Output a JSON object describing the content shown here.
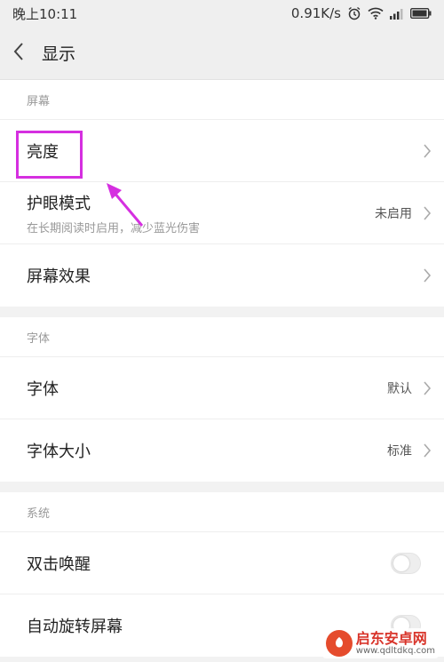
{
  "status_bar": {
    "time": "晚上10:11",
    "speed": "0.91K/s",
    "battery_icon": "battery-icon",
    "alarm_icon": "alarm-clock-icon",
    "wifi_icon": "wifi-icon",
    "signal_icon": "signal-icon"
  },
  "header": {
    "back_icon": "chevron-left-icon",
    "title": "显示"
  },
  "sections": {
    "screen": {
      "header": "屏幕",
      "brightness": {
        "label": "亮度"
      },
      "eye_mode": {
        "label": "护眼模式",
        "sub": "在长期阅读时启用，减少蓝光伤害",
        "value": "未启用"
      },
      "screen_effect": {
        "label": "屏幕效果"
      }
    },
    "font": {
      "header": "字体",
      "font": {
        "label": "字体",
        "value": "默认"
      },
      "font_size": {
        "label": "字体大小",
        "value": "标准"
      }
    },
    "system": {
      "header": "系统",
      "double_tap": {
        "label": "双击唤醒",
        "enabled": false
      },
      "auto_rotate": {
        "label": "自动旋转屏幕"
      }
    }
  },
  "annotation": {
    "highlight_color": "#d52fe0",
    "target": "亮度"
  },
  "watermark": {
    "name": "启东安卓网",
    "url": "www.qdltdkq.com"
  },
  "colors": {
    "background": "#f2f2f2",
    "section_header": "#999999",
    "toggle_off": "#eeeeee"
  }
}
